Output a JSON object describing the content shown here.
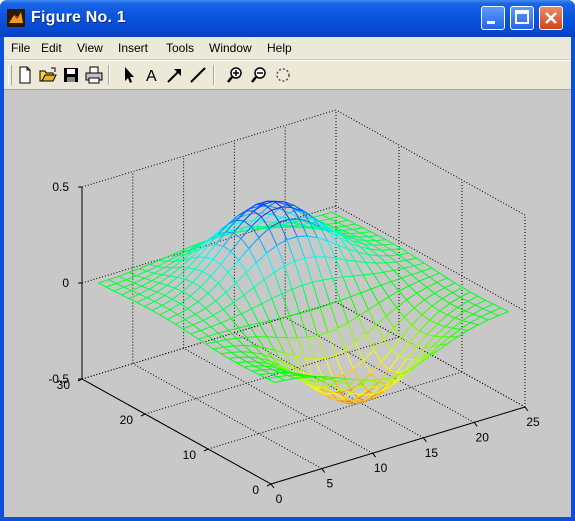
{
  "window": {
    "title": "Figure No. 1"
  },
  "menu": [
    "File",
    "Edit",
    "View",
    "Insert",
    "Tools",
    "Window",
    "Help"
  ],
  "toolbar": {
    "buttons": [
      "new-figure",
      "open-file",
      "save",
      "print",
      "edit-plot-arrow",
      "insert-text",
      "insert-arrow",
      "insert-line",
      "zoom-in",
      "zoom-out",
      "rotate-3d"
    ]
  },
  "colors": {
    "title_bar": "#0a55de",
    "figure_bg": "#c8c8c8",
    "menu_bg": "#ece9d8"
  },
  "chart_data": {
    "type": "surface-mesh",
    "colormap": "hsv",
    "grid": true,
    "x_ticks": [
      "0",
      "5",
      "10",
      "15",
      "20",
      "25"
    ],
    "y_ticks": [
      "0",
      "10",
      "20",
      "30"
    ],
    "z_ticks": [
      "-0.5",
      "0",
      "0.5"
    ],
    "xlim": [
      0,
      25
    ],
    "ylim": [
      0,
      30
    ],
    "zlim": [
      -0.5,
      0.5
    ],
    "grid_points": [
      24,
      24
    ],
    "surface": "z = 0.4·exp(-((x-12.5)²+(y-20)²)/40) − 0.4·exp(-((x-12.5)²+(y-7)²)/40)",
    "peak": {
      "x": 12.5,
      "y": 20,
      "z": 0.4
    },
    "trough": {
      "x": 12.5,
      "y": 7,
      "z": -0.4
    }
  }
}
